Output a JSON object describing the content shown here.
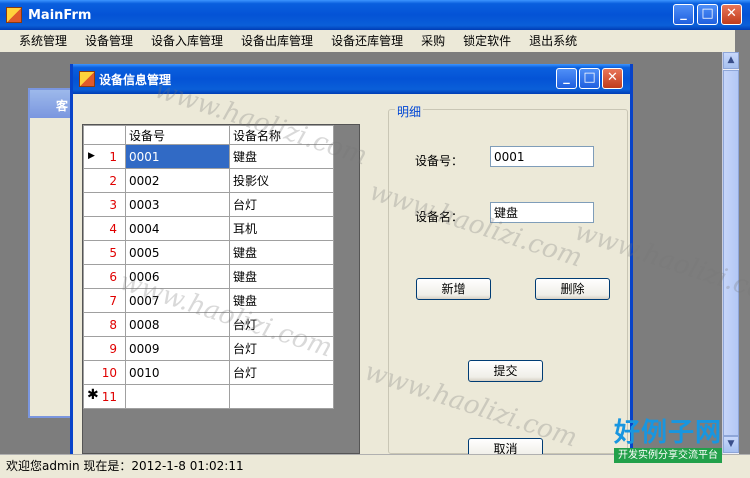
{
  "main_window": {
    "title": "MainFrm"
  },
  "menu": [
    {
      "label": "系统管理"
    },
    {
      "label": "设备管理"
    },
    {
      "label": "设备入库管理"
    },
    {
      "label": "设备出库管理"
    },
    {
      "label": "设备还库管理"
    },
    {
      "label": "采购"
    },
    {
      "label": "锁定软件"
    },
    {
      "label": "退出系统"
    }
  ],
  "background_window": {
    "title_fragment": "客"
  },
  "child_window": {
    "title": "设备信息管理"
  },
  "grid": {
    "headers": [
      "设备号",
      "设备名称"
    ],
    "rows": [
      {
        "num": "1",
        "id": "0001",
        "name": "键盘"
      },
      {
        "num": "2",
        "id": "0002",
        "name": "投影仪"
      },
      {
        "num": "3",
        "id": "0003",
        "name": "台灯"
      },
      {
        "num": "4",
        "id": "0004",
        "name": "耳机"
      },
      {
        "num": "5",
        "id": "0005",
        "name": "键盘"
      },
      {
        "num": "6",
        "id": "0006",
        "name": "键盘"
      },
      {
        "num": "7",
        "id": "0007",
        "name": "键盘"
      },
      {
        "num": "8",
        "id": "0008",
        "name": "台灯"
      },
      {
        "num": "9",
        "id": "0009",
        "name": "台灯"
      },
      {
        "num": "10",
        "id": "0010",
        "name": "台灯"
      }
    ],
    "new_row_num": "11"
  },
  "detail": {
    "caption": "明细",
    "device_id_label": "设备号：",
    "device_id_value": "0001",
    "device_name_label": "设备名：",
    "device_name_value": "键盘",
    "add_button": "新增",
    "delete_button": "删除",
    "submit_button": "提交",
    "cancel_button": "取消"
  },
  "status": {
    "text": "欢迎您admin  现在是：2012-1-8 01:02:11"
  },
  "watermark": {
    "text": "www.haolizi.com",
    "logo_big": "好例子网",
    "logo_small": "开发实例分享交流平台"
  },
  "colors": {
    "title_bar": "#0453d6",
    "selection": "#316ac5",
    "row_number": "#e00000",
    "caption": "#0046d5"
  }
}
